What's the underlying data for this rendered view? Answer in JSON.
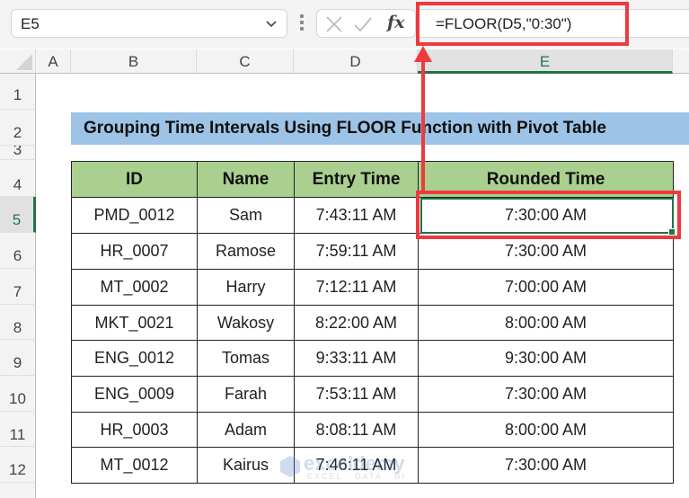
{
  "formula_bar": {
    "name_box": "E5",
    "cancel_icon": "x-icon",
    "enter_icon": "check-icon",
    "fx_label": "fx",
    "formula": "=FLOOR(D5,\"0:30\")"
  },
  "columns": [
    "A",
    "B",
    "C",
    "D",
    "E"
  ],
  "active_column": "E",
  "rows": [
    "1",
    "2",
    "3",
    "4",
    "5",
    "6",
    "7",
    "8",
    "9",
    "10",
    "11",
    "12"
  ],
  "active_row": "5",
  "title": "Grouping Time Intervals Using FLOOR Function with Pivot Table",
  "table": {
    "headers": [
      "ID",
      "Name",
      "Entry Time",
      "Rounded Time"
    ],
    "rows": [
      [
        "PMD_0012",
        "Sam",
        "7:43:11 AM",
        "7:30:00 AM"
      ],
      [
        "HR_0007",
        "Ramose",
        "7:59:11 AM",
        "7:30:00 AM"
      ],
      [
        "MT_0002",
        "Harry",
        "7:12:11 AM",
        "7:00:00 AM"
      ],
      [
        "MKT_0021",
        "Wakosy",
        "8:22:00 AM",
        "8:00:00 AM"
      ],
      [
        "ENG_0012",
        "Tomas",
        "9:33:11 AM",
        "9:30:00 AM"
      ],
      [
        "ENG_0009",
        "Farah",
        "7:53:11 AM",
        "7:30:00 AM"
      ],
      [
        "HR_0003",
        "Adam",
        "8:08:11 AM",
        "8:00:00 AM"
      ],
      [
        "MT_0012",
        "Kairus",
        "7:46:11 AM",
        "7:30:00 AM"
      ]
    ]
  },
  "annotation": {
    "highlight_color": "#ee3a3e",
    "description": "arrow from cell E5 to formula bar"
  },
  "watermark": {
    "brand": "exceldemy",
    "tagline": "EXCEL · DATA · BI"
  },
  "colors": {
    "title_bg": "#9dc3e6",
    "header_bg": "#a9d08e",
    "selection": "#217346"
  }
}
